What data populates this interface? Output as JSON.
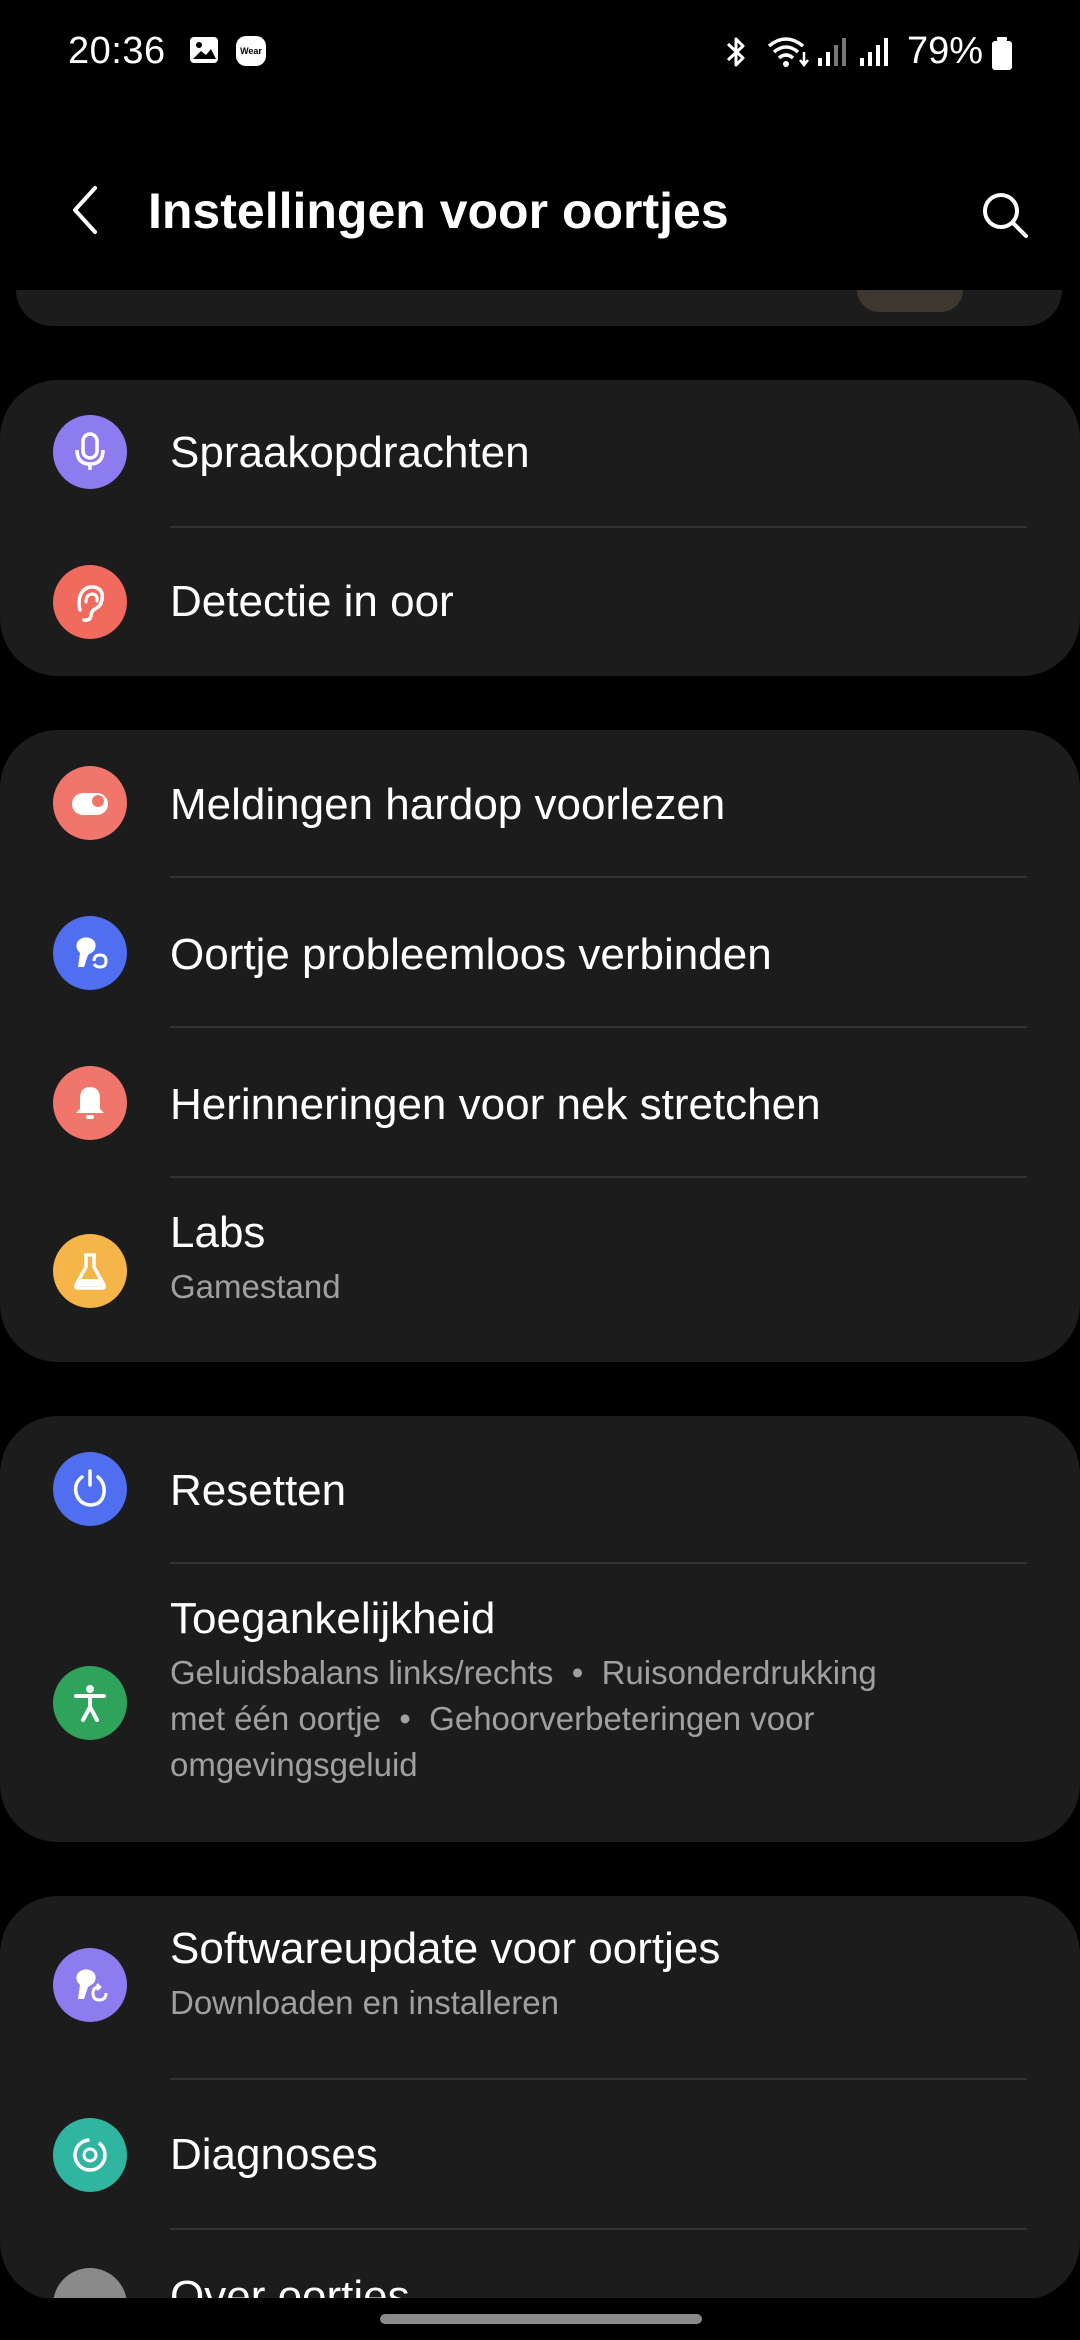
{
  "status_bar": {
    "time": "20:36",
    "battery": "79%",
    "icons": [
      "gallery-icon",
      "wear-icon",
      "bluetooth-icon",
      "wifi-icon",
      "signal-icon",
      "signal-icon",
      "battery-icon"
    ],
    "wear_label": "Wear"
  },
  "header": {
    "title": "Instellingen voor oortjes"
  },
  "groups": [
    {
      "items": [
        {
          "label": "Spraakopdrachten",
          "icon": "microphone-icon",
          "color": "#8c7cf0"
        },
        {
          "label": "Detectie in oor",
          "icon": "ear-icon",
          "color": "#f06a5e"
        }
      ]
    },
    {
      "items": [
        {
          "label": "Meldingen hardop voorlezen",
          "icon": "notification-icon",
          "color": "#f0766b"
        },
        {
          "label": "Oortje probleemloos verbinden",
          "icon": "earbud-switch-icon",
          "color": "#4f6ff0"
        },
        {
          "label": "Herinneringen voor nek stretchen",
          "icon": "bell-icon",
          "color": "#f0766b"
        },
        {
          "label": "Labs",
          "subtitle": "Gamestand",
          "icon": "flask-icon",
          "color": "#f5b548"
        }
      ]
    },
    {
      "items": [
        {
          "label": "Resetten",
          "icon": "reset-icon",
          "color": "#4f6ff0"
        },
        {
          "label": "Toegankelijkheid",
          "subtitle_lines": [
            "Geluidsbalans links/rechts  •  Ruisonderdrukking",
            "met één oortje  •  Gehoorverbeteringen voor",
            "omgevingsgeluid"
          ],
          "icon": "accessibility-icon",
          "color": "#2fa35c"
        }
      ]
    },
    {
      "items": [
        {
          "label": "Softwareupdate voor oortjes",
          "subtitle": "Downloaden en installeren",
          "icon": "software-update-icon",
          "color": "#8c7cf0"
        },
        {
          "label": "Diagnoses",
          "icon": "diagnostics-icon",
          "color": "#2fb5a0"
        },
        {
          "label": "Over oortjes",
          "icon": "info-icon",
          "color": "#8a8a8a"
        }
      ]
    }
  ]
}
